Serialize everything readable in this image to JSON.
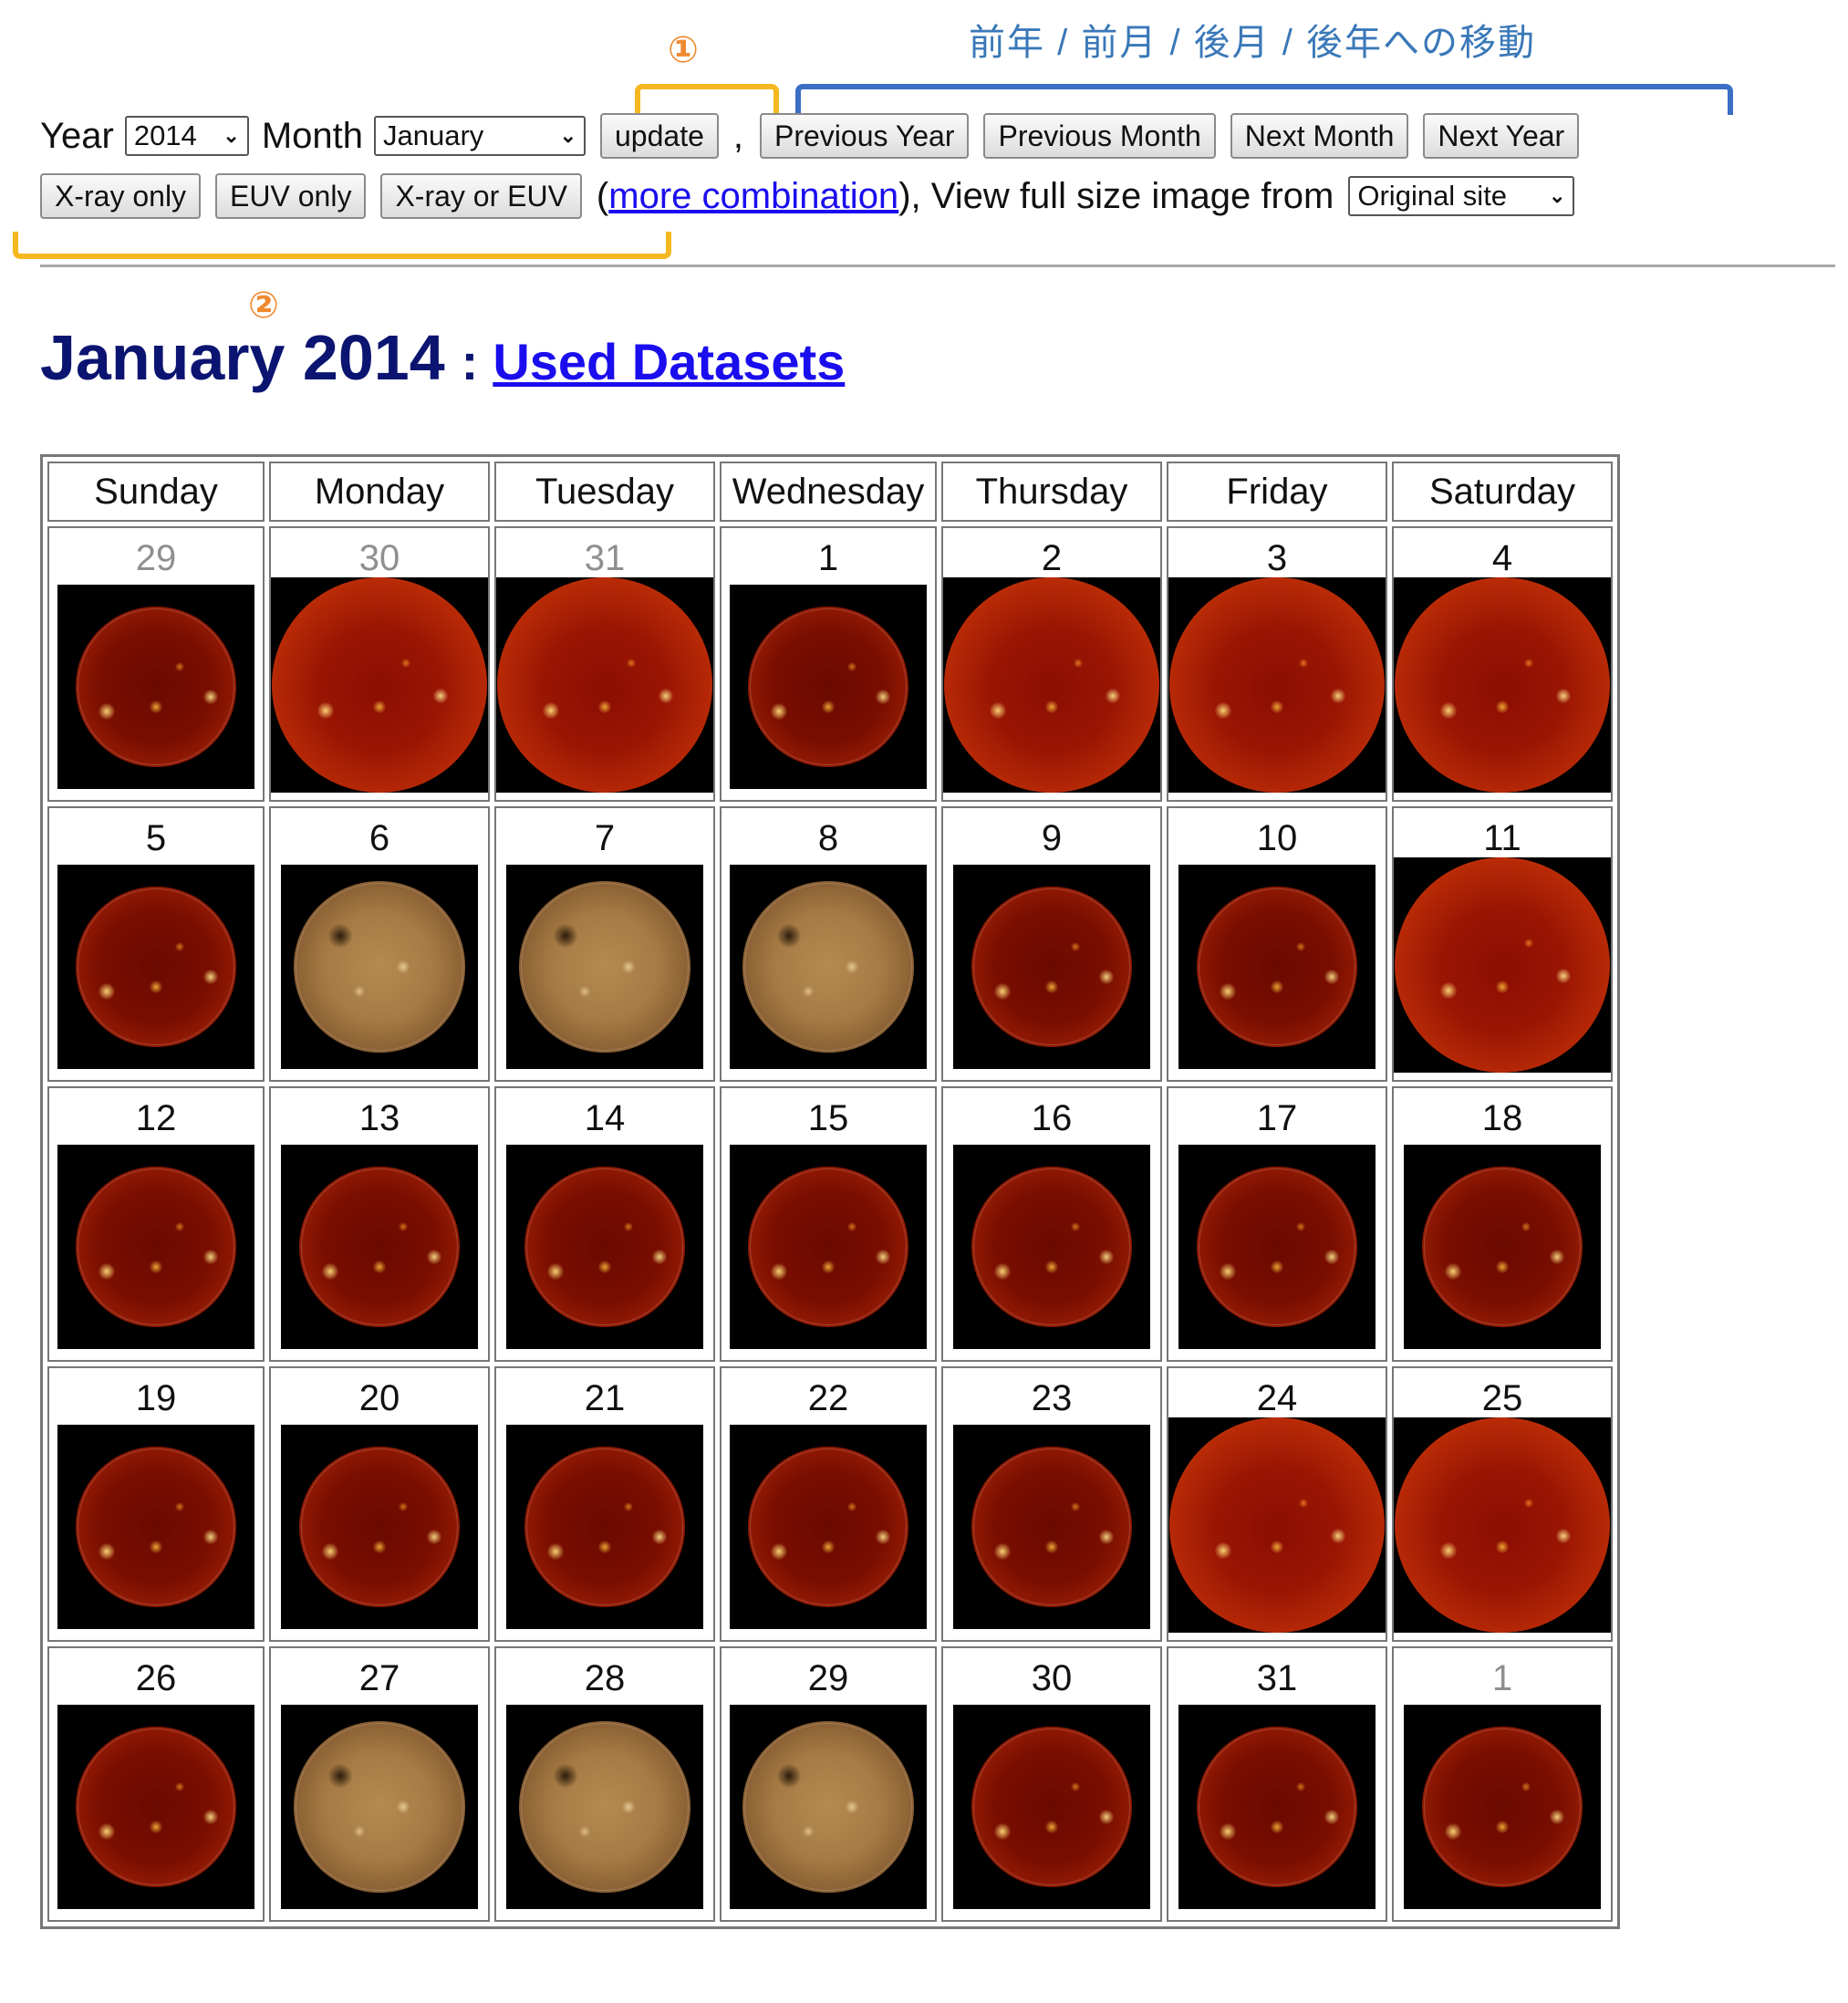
{
  "annotations": {
    "nav_note": "前年 / 前月 / 後月 / 後年への移動",
    "marker_1": "①",
    "marker_2": "②"
  },
  "controls": {
    "year_label": "Year",
    "year_value": "2014",
    "month_label": "Month",
    "month_value": "January",
    "update_label": "update",
    "comma": ",",
    "prev_year": "Previous Year",
    "prev_month": "Previous Month",
    "next_month": "Next Month",
    "next_year": "Next Year",
    "xray_only": "X-ray only",
    "euv_only": "EUV only",
    "xray_or_euv": "X-ray or EUV",
    "paren_open": "(",
    "more_combination": "more combination",
    "view_text": "), View full size image from",
    "source_value": "Original site"
  },
  "heading": {
    "title": "January 2014",
    "separator": ":",
    "datasets_link": "Used Datasets"
  },
  "calendar": {
    "weekdays": [
      "Sunday",
      "Monday",
      "Tuesday",
      "Wednesday",
      "Thursday",
      "Friday",
      "Saturday"
    ],
    "weeks": [
      [
        {
          "day": "29",
          "other": true,
          "img": "xray"
        },
        {
          "day": "30",
          "other": true,
          "img": "xrt"
        },
        {
          "day": "31",
          "other": true,
          "img": "xrt"
        },
        {
          "day": "1",
          "other": false,
          "img": "xray"
        },
        {
          "day": "2",
          "other": false,
          "img": "xrt"
        },
        {
          "day": "3",
          "other": false,
          "img": "xrt"
        },
        {
          "day": "4",
          "other": false,
          "img": "xrt"
        }
      ],
      [
        {
          "day": "5",
          "other": false,
          "img": "xray"
        },
        {
          "day": "6",
          "other": false,
          "img": "euv"
        },
        {
          "day": "7",
          "other": false,
          "img": "euv"
        },
        {
          "day": "8",
          "other": false,
          "img": "euv"
        },
        {
          "day": "9",
          "other": false,
          "img": "xray"
        },
        {
          "day": "10",
          "other": false,
          "img": "xray"
        },
        {
          "day": "11",
          "other": false,
          "img": "xrt"
        }
      ],
      [
        {
          "day": "12",
          "other": false,
          "img": "xray"
        },
        {
          "day": "13",
          "other": false,
          "img": "xray"
        },
        {
          "day": "14",
          "other": false,
          "img": "xray"
        },
        {
          "day": "15",
          "other": false,
          "img": "xray"
        },
        {
          "day": "16",
          "other": false,
          "img": "xray"
        },
        {
          "day": "17",
          "other": false,
          "img": "xray"
        },
        {
          "day": "18",
          "other": false,
          "img": "xray"
        }
      ],
      [
        {
          "day": "19",
          "other": false,
          "img": "xray"
        },
        {
          "day": "20",
          "other": false,
          "img": "xray"
        },
        {
          "day": "21",
          "other": false,
          "img": "xray"
        },
        {
          "day": "22",
          "other": false,
          "img": "xray"
        },
        {
          "day": "23",
          "other": false,
          "img": "xray"
        },
        {
          "day": "24",
          "other": false,
          "img": "xrt"
        },
        {
          "day": "25",
          "other": false,
          "img": "xrt"
        }
      ],
      [
        {
          "day": "26",
          "other": false,
          "img": "xray"
        },
        {
          "day": "27",
          "other": false,
          "img": "euv"
        },
        {
          "day": "28",
          "other": false,
          "img": "euv"
        },
        {
          "day": "29",
          "other": false,
          "img": "euv"
        },
        {
          "day": "30",
          "other": false,
          "img": "xray"
        },
        {
          "day": "31",
          "other": false,
          "img": "xray"
        },
        {
          "day": "1",
          "other": true,
          "img": "xray"
        }
      ]
    ]
  },
  "colors": {
    "heading": "#0b1470",
    "link": "#1a0dee",
    "annotation_blue": "#3a78b8",
    "annotation_orange": "#f08a30",
    "bracket_yellow": "#f5b820",
    "bracket_blue": "#3a6fc4"
  }
}
